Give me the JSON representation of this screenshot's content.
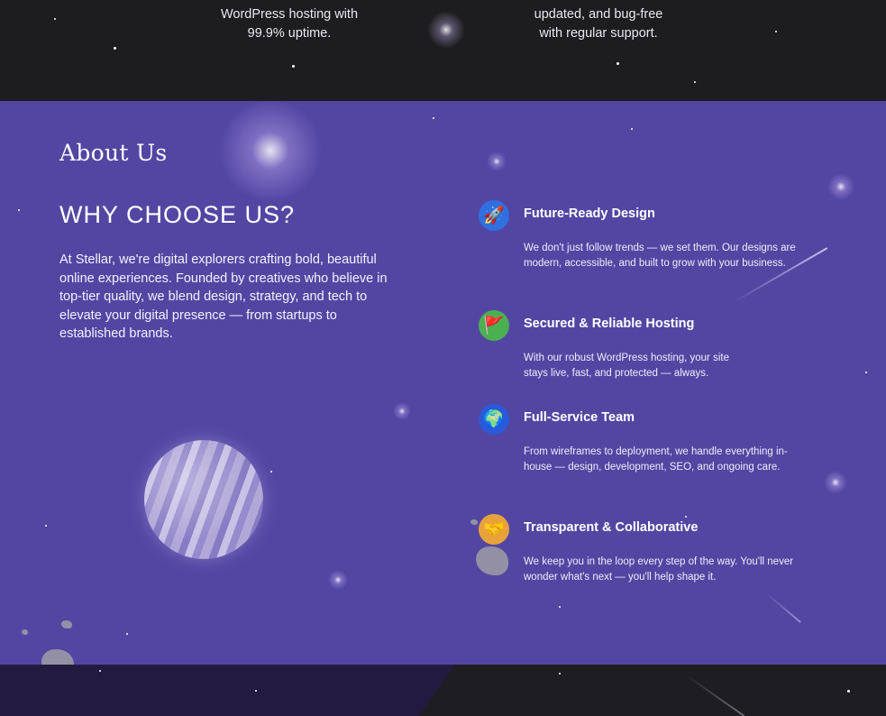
{
  "top": {
    "left_text": [
      "WordPress hosting with",
      "99.9% uptime."
    ],
    "right_text": [
      "updated, and bug-free",
      "with regular support."
    ]
  },
  "about": {
    "section_title": "About Us",
    "heading": "WHY CHOOSE US?",
    "intro": "At Stellar, we're digital explorers crafting bold, beautiful online experiences. Founded by creatives who believe in top-tier quality, we blend design, strategy, and tech to elevate your digital presence — from startups to established brands."
  },
  "features": [
    {
      "icon": "rocket-icon",
      "title": "Future-Ready Design",
      "description": "We don't just follow trends — we set them. Our designs are modern, accessible, and built to grow with your business."
    },
    {
      "icon": "planet-flag-icon",
      "title": "Secured & Reliable Hosting",
      "description": "With our robust WordPress hosting, your site stays live, fast, and protected — always."
    },
    {
      "icon": "globe-orbit-icon",
      "title": "Full-Service Team",
      "description": "From wireframes to deployment, we handle everything in-house — design, development, SEO, and ongoing care."
    },
    {
      "icon": "collaboration-icon",
      "title": "Transparent & Collaborative",
      "description": "We keep you in the loop every step of the way. You'll never wonder what's next — you'll help shape it."
    }
  ],
  "colors": {
    "section_background": "#5346a3",
    "dark_background": "#1d1d1f",
    "text": "#ffffff"
  }
}
